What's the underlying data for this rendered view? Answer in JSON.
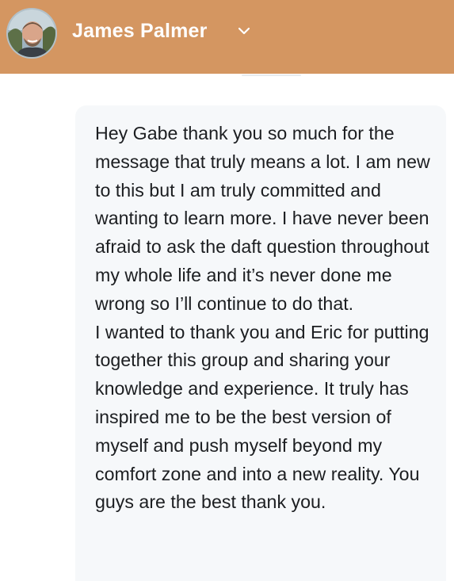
{
  "header": {
    "contact_name": "James Palmer",
    "background_color": "#d49661",
    "avatar_icon": "user-avatar",
    "chevron_icon": "chevron-down-icon"
  },
  "message": {
    "paragraphs": [
      "Hey Gabe thank you so much for the message that truly means a lot. I am new to this but I am truly committed and wanting to learn more. I have never been afraid to ask the daft question throughout my whole life and it’s never done me wrong so I’ll continue to do that.",
      "I wanted to thank you and Eric for putting together this group and sharing your knowledge and experience. It truly has inspired me to be the best version of myself and push myself beyond my comfort zone and into a new reality. You guys are the best thank you."
    ],
    "bubble_color": "#f6f8fa",
    "text_color": "#1c1e21"
  }
}
